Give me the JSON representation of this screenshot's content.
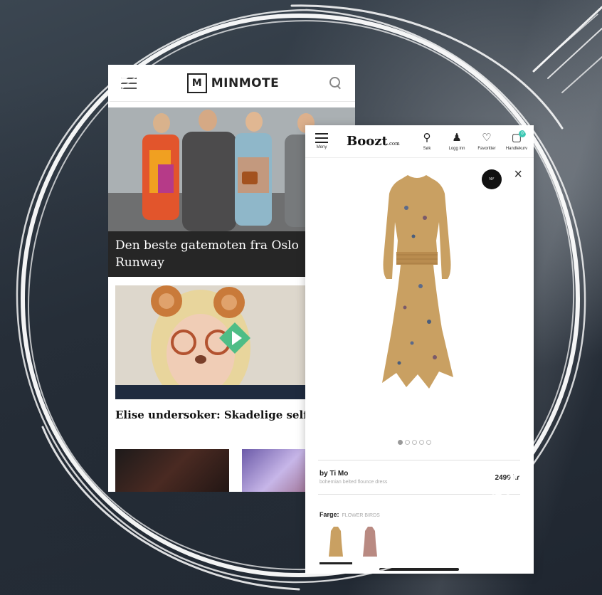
{
  "minmote": {
    "logo_mark": "M",
    "logo_text": "MINMOTE",
    "article1_title": "Den beste gatemoten fra Oslo Runway",
    "article2_title": "Elise undersoker: Skadelige selfie-filtre"
  },
  "boozt": {
    "logo": "Boozt",
    "logo_suffix": ".com",
    "menu_label": "Meny",
    "nav": [
      {
        "label": "Søk",
        "icon": "search-icon"
      },
      {
        "label": "Logg inn",
        "icon": "user-icon"
      },
      {
        "label": "Favoritter",
        "icon": "heart-icon"
      },
      {
        "label": "Handlekurv",
        "icon": "bag-icon"
      }
    ],
    "cart_count": "0",
    "badge_text": "NY",
    "close_label": "×",
    "pager": {
      "total": 5,
      "active": 1
    },
    "product": {
      "brand": "by Ti Mo",
      "description": "bohemian belted flounce dress",
      "price": "2499 kr"
    },
    "color_label": "Farge:",
    "color_value": "FLOWER BIRDS"
  },
  "colors": {
    "accent_teal": "#3cc8b4",
    "dress_mustard": "#c9a062",
    "dress_rose": "#b98a82",
    "caption_bg": "#262626"
  }
}
